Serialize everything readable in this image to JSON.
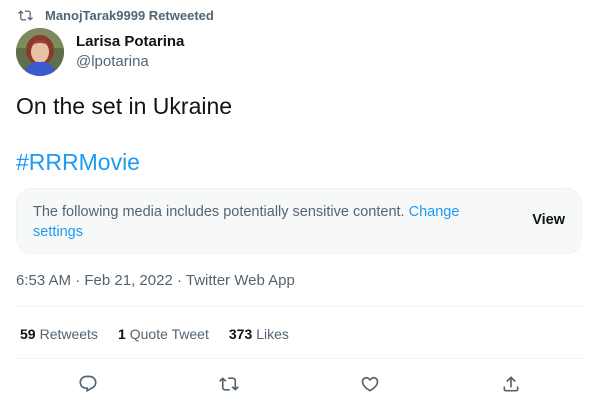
{
  "retweet": {
    "text": "ManojTarak9999 Retweeted",
    "icon": "retweet-icon"
  },
  "author": {
    "display_name": "Larisa Potarina",
    "handle": "@lpotarina"
  },
  "tweet": {
    "text": "On the set in Ukraine",
    "hashtag": "#RRRMovie"
  },
  "sensitive_notice": {
    "message": "The following media includes potentially sensitive content.",
    "link_label": "Change settings",
    "view_label": "View"
  },
  "meta": {
    "time": "6:53 AM",
    "separator": "·",
    "date": "Feb 21, 2022",
    "source": "Twitter Web App"
  },
  "stats": [
    {
      "count": "59",
      "label": "Retweets"
    },
    {
      "count": "1",
      "label": "Quote Tweet"
    },
    {
      "count": "373",
      "label": "Likes"
    }
  ],
  "actions": [
    {
      "name": "reply",
      "icon": "reply-icon"
    },
    {
      "name": "retweet",
      "icon": "retweet-icon"
    },
    {
      "name": "like",
      "icon": "heart-icon"
    },
    {
      "name": "share",
      "icon": "share-icon"
    }
  ],
  "colors": {
    "accent": "#1d9bf0",
    "text_primary": "#0f1419",
    "text_secondary": "#536471",
    "notice_bg": "#f7f9f9",
    "divider": "#eff3f4"
  }
}
